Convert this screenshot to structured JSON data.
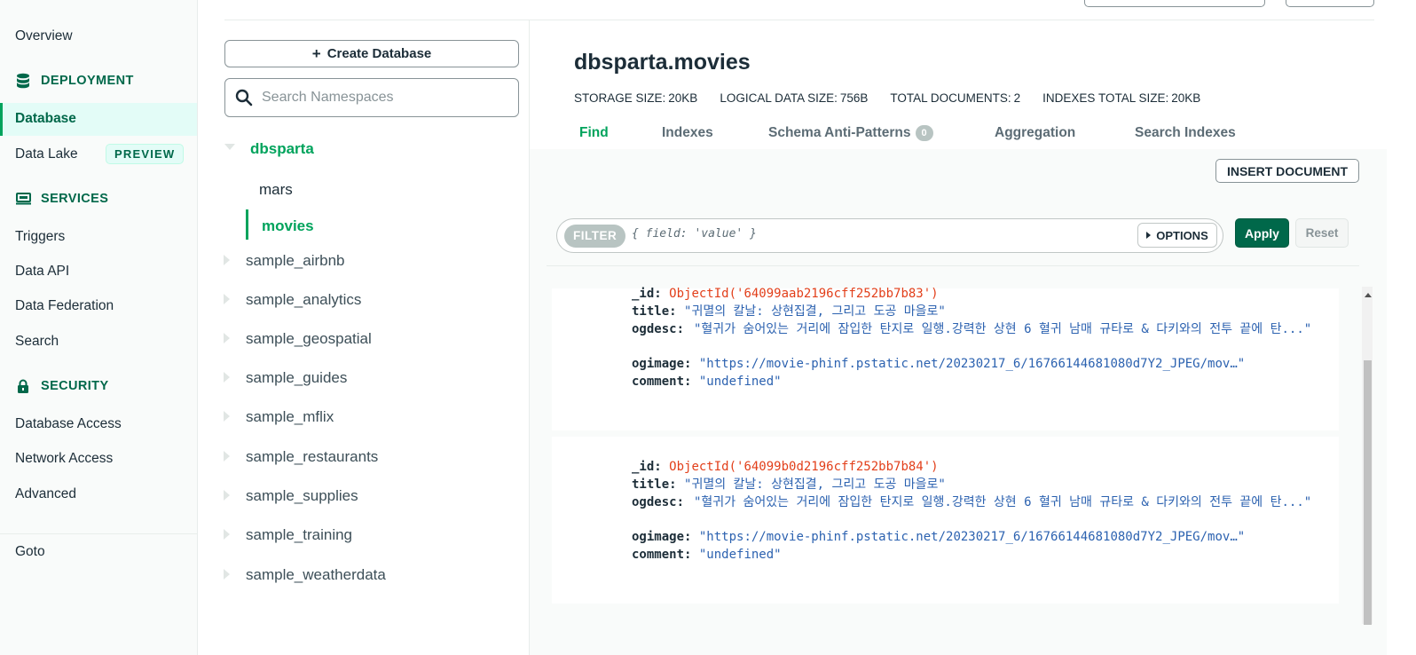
{
  "nav": {
    "overview": "Overview",
    "deployment": {
      "title": "DEPLOYMENT",
      "icon": "database-icon"
    },
    "database": "Database",
    "data_lake": "Data Lake",
    "preview_badge": "PREVIEW",
    "services": {
      "title": "SERVICES",
      "icon": "services-icon"
    },
    "triggers": "Triggers",
    "data_api": "Data API",
    "data_federation": "Data Federation",
    "search": "Search",
    "security": {
      "title": "SECURITY",
      "icon": "lock-icon"
    },
    "database_access": "Database Access",
    "network_access": "Network Access",
    "advanced": "Advanced",
    "goto": "Goto"
  },
  "namespaces": {
    "create_label": "Create Database",
    "search_placeholder": "Search Namespaces",
    "database": "dbsparta",
    "collections": [
      "mars",
      "movies"
    ],
    "others": [
      "sample_airbnb",
      "sample_analytics",
      "sample_geospatial",
      "sample_guides",
      "sample_mflix",
      "sample_restaurants",
      "sample_supplies",
      "sample_training",
      "sample_weatherdata"
    ]
  },
  "collection": {
    "title": "dbsparta.movies",
    "stats": [
      {
        "label": "STORAGE SIZE:",
        "value": "20KB"
      },
      {
        "label": "LOGICAL DATA SIZE:",
        "value": "756B"
      },
      {
        "label": "TOTAL DOCUMENTS:",
        "value": "2"
      },
      {
        "label": "INDEXES TOTAL SIZE:",
        "value": "20KB"
      }
    ],
    "tabs": [
      "Find",
      "Indexes",
      "Schema Anti-Patterns",
      "Aggregation",
      "Search Indexes"
    ],
    "anti_patterns_count": "0"
  },
  "toolbar": {
    "insert_label": "INSERT DOCUMENT",
    "filter_label": "FILTER",
    "filter_placeholder": "{ field: 'value' }",
    "options_label": "OPTIONS",
    "apply_label": "Apply",
    "reset_label": "Reset"
  },
  "documents": [
    {
      "id_key": "_id:",
      "id_value": "ObjectId('64099aab2196cff252bb7b83')",
      "title_key": "title:",
      "title_value": "\"귀멸의 칼날: 상현집결, 그리고 도공 마을로\"",
      "ogdesc_key": "ogdesc:",
      "ogdesc_value": "\"혈귀가 숨어있는 거리에 잠입한 탄지로 일행.강력한 상현 6 혈귀 남매 규타로 & 다키와의 전투 끝에 탄...\"",
      "ogimage_key": "ogimage:",
      "ogimage_value": "\"https://movie-phinf.pstatic.net/20230217_6/16766144681080d7Y2_JPEG/mov…\"",
      "comment_key": "comment:",
      "comment_value": "\"undefined\""
    },
    {
      "id_key": "_id:",
      "id_value": "ObjectId('64099b0d2196cff252bb7b84')",
      "title_key": "title:",
      "title_value": "\"귀멸의 칼날: 상현집결, 그리고 도공 마을로\"",
      "ogdesc_key": "ogdesc:",
      "ogdesc_value": "\"혈귀가 숨어있는 거리에 잠입한 탄지로 일행.강력한 상현 6 혈귀 남매 규타로 & 다키와의 전투 끝에 탄...\"",
      "ogimage_key": "ogimage:",
      "ogimage_value": "\"https://movie-phinf.pstatic.net/20230217_6/16766144681080d7Y2_JPEG/mov…\"",
      "comment_key": "comment:",
      "comment_value": "\"undefined\""
    }
  ],
  "colors": {
    "brand_green": "#00684a",
    "accent_green": "#00a35c",
    "object_id": "#e23f1a",
    "string_value": "#2c62b0"
  }
}
